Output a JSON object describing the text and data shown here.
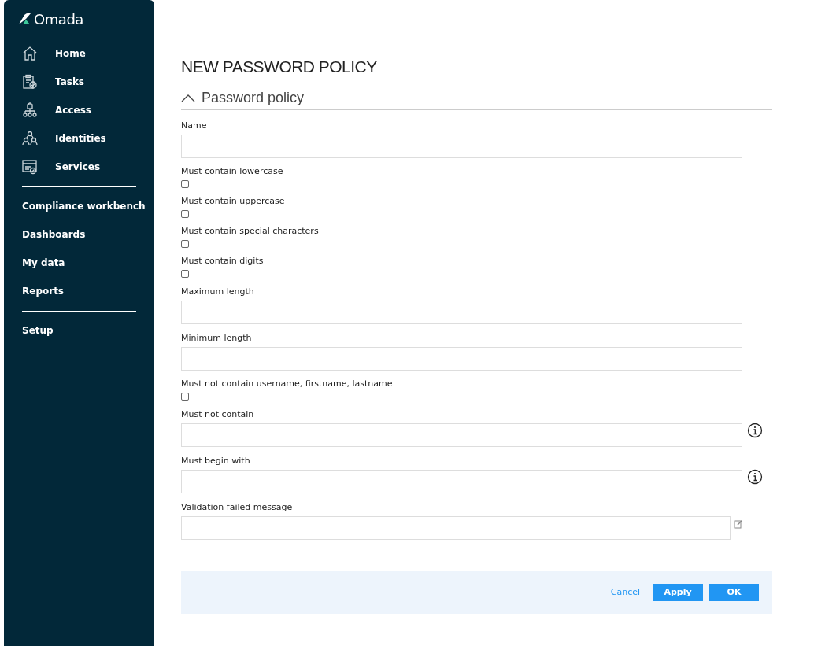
{
  "sidebar": {
    "logo": "Omada",
    "main_items": [
      {
        "label": "Home"
      },
      {
        "label": "Tasks"
      },
      {
        "label": "Access"
      },
      {
        "label": "Identities"
      },
      {
        "label": "Services"
      }
    ],
    "groups": [
      [
        {
          "label": "Compliance workbench"
        },
        {
          "label": "Dashboards"
        },
        {
          "label": "My data"
        },
        {
          "label": "Reports"
        }
      ],
      [
        {
          "label": "Setup"
        }
      ]
    ]
  },
  "page_title": "NEW PASSWORD POLICY",
  "section": {
    "title": "Password policy",
    "expanded": true
  },
  "fields": [
    {
      "kind": "text",
      "label": "Name"
    },
    {
      "kind": "checkbox",
      "label": "Must contain lowercase",
      "checked": false
    },
    {
      "kind": "checkbox",
      "label": "Must contain uppercase",
      "checked": false
    },
    {
      "kind": "checkbox",
      "label": "Must contain special characters",
      "checked": false
    },
    {
      "kind": "checkbox",
      "label": "Must contain digits",
      "checked": false
    },
    {
      "kind": "text",
      "label": "Maximum length"
    },
    {
      "kind": "text",
      "label": "Minimum length"
    },
    {
      "kind": "checkbox",
      "label": "Must not contain username, firstname, lastname",
      "checked": false
    },
    {
      "kind": "text_with_info",
      "label": "Must not contain"
    },
    {
      "kind": "text_with_info",
      "label": "Must begin with"
    },
    {
      "kind": "text_with_edit",
      "label": "Validation failed message"
    }
  ],
  "footer": {
    "cancel": "Cancel",
    "apply": "Apply",
    "ok": "OK"
  }
}
